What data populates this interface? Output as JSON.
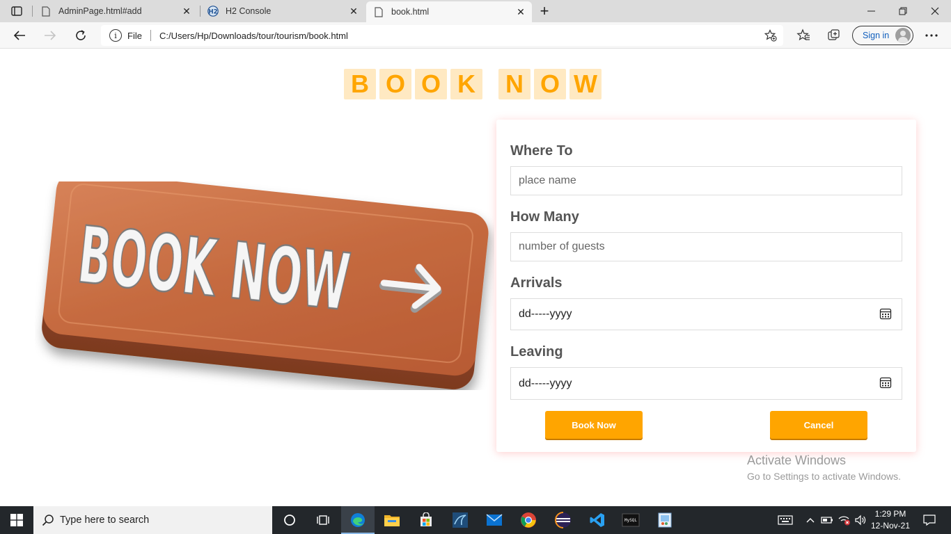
{
  "browser": {
    "tabs": [
      {
        "title": "AdminPage.html#add",
        "icon": "file-icon",
        "active": false
      },
      {
        "title": "H2 Console",
        "icon": "h2-icon",
        "active": false
      },
      {
        "title": "book.html",
        "icon": "file-icon",
        "active": true
      }
    ],
    "address": {
      "scheme": "File",
      "url": "C:/Users/Hp/Downloads/tour/tourism/book.html"
    },
    "sign_in_label": "Sign in"
  },
  "page": {
    "heading_letters": [
      "B",
      "O",
      "O",
      "K",
      "N",
      "O",
      "W"
    ],
    "image_text": "BOOK NOW",
    "form": {
      "where_label": "Where To",
      "where_placeholder": "place name",
      "howmany_label": "How Many",
      "howmany_placeholder": "number of guests",
      "arrivals_label": "Arrivals",
      "arrivals_value": "dd-----yyyy",
      "leaving_label": "Leaving",
      "leaving_value": "dd-----yyyy",
      "book_button": "Book Now",
      "cancel_button": "Cancel"
    },
    "watermark": {
      "line1": "Activate Windows",
      "line2": "Go to Settings to activate Windows."
    }
  },
  "taskbar": {
    "search_placeholder": "Type here to search",
    "time": "1:29 PM",
    "date": "12-Nov-21"
  },
  "colors": {
    "accent": "#ffa500",
    "heading_bg": "#ffe9c2",
    "brick": "#c66a3e",
    "taskbar": "#23272b"
  }
}
